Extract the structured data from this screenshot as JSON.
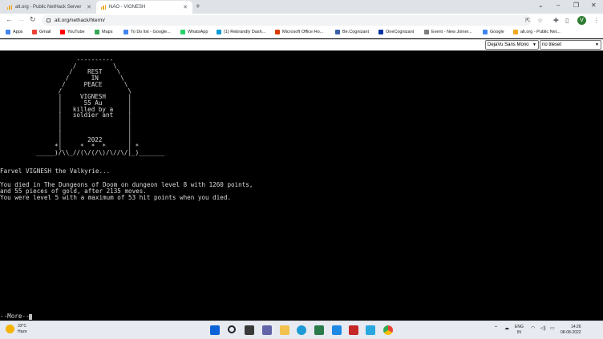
{
  "browser": {
    "tabs": [
      {
        "title": "alt.org - Public NetHack Server",
        "active": false
      },
      {
        "title": "NAO - VIGNESH",
        "active": true
      }
    ],
    "new_tab_glyph": "+",
    "url": "alt.org/nethack/hterm/",
    "bookmarks": [
      {
        "label": "Apps",
        "icon": "apps-grid-icon",
        "color": "#4285f4"
      },
      {
        "label": "Gmail",
        "icon": "gmail-icon",
        "color": "#ea4335"
      },
      {
        "label": "YouTube",
        "icon": "youtube-icon",
        "color": "#ff0000"
      },
      {
        "label": "Maps",
        "icon": "maps-icon",
        "color": "#34a853"
      },
      {
        "label": "To Do list - Google...",
        "icon": "doc-icon",
        "color": "#4285f4"
      },
      {
        "label": "WhatsApp",
        "icon": "whatsapp-icon",
        "color": "#25d366"
      },
      {
        "label": "(1) Rebrandly Dash...",
        "icon": "rebrandly-icon",
        "color": "#0b9bd6"
      },
      {
        "label": "Microsoft Office Ho...",
        "icon": "office-icon",
        "color": "#d83b01"
      },
      {
        "label": "Be.Cognizant",
        "icon": "cognizant-icon",
        "color": "#3b5fa8"
      },
      {
        "label": "OneCognizant",
        "icon": "onecognizant-icon",
        "color": "#0033a1"
      },
      {
        "label": "Event - New Joiner...",
        "icon": "event-icon",
        "color": "#7d7d7d"
      },
      {
        "label": "Google",
        "icon": "google-icon",
        "color": "#4285f4"
      },
      {
        "label": "alt.org - Public Net...",
        "icon": "altorg-icon",
        "color": "#f1a81e"
      }
    ],
    "profile_initial": "V"
  },
  "page": {
    "font_select": "DejaVu Sans Mono",
    "tileset_select": "no tileset"
  },
  "terminal": {
    "tombstone": [
      "             ----------",
      "            /          \\",
      "           /    REST    \\",
      "          /      IN      \\",
      "         /     PEACE      \\",
      "        /                  \\",
      "        |     VIGNESH      |",
      "        |      55 Au       |",
      "        |   killed by a    |",
      "        |   soldier ant    |",
      "        |                  |",
      "        |                  |",
      "        |                  |",
      "        |       2022       |",
      "       *|     *  *  *      | *",
      "  _____)/\\\\_//(\\/(/\\)/\\//\\/|_)_______"
    ],
    "farewell": "Farvel VIGNESH the Valkyrie...",
    "summary_1": "You died in The Dungeons of Doom on dungeon level 8 with 1260 points,",
    "summary_2": "and 55 pieces of gold, after 2135 moves.",
    "summary_3": "You were level 5 with a maximum of 53 hit points when you died.",
    "more_prompt": "--More--"
  },
  "taskbar": {
    "temperature": "33°C",
    "condition": "Haze",
    "lang_1": "ENG",
    "lang_2": "IN",
    "time": "14:26",
    "date": "08-08-2022"
  }
}
